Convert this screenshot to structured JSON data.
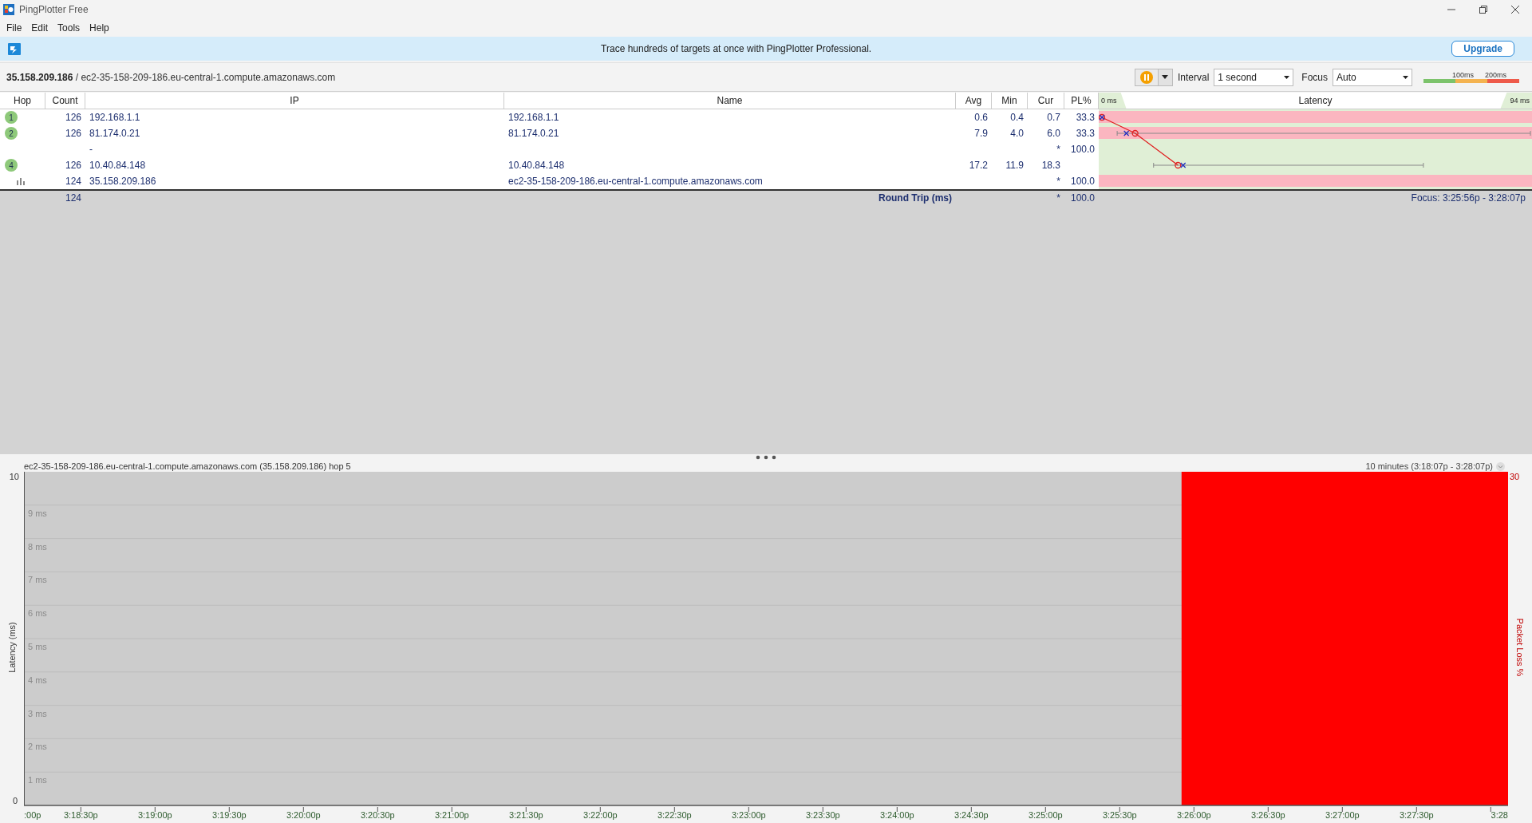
{
  "window": {
    "title": "PingPlotter Free"
  },
  "menu": [
    "File",
    "Edit",
    "Tools",
    "Help"
  ],
  "banner": {
    "message": "Trace hundreds of targets at once with PingPlotter Professional.",
    "button": "Upgrade"
  },
  "target": {
    "address": "**35.158.209.186** / ec2-35-158-209-186.eu-central-1.compute.amazonaws.com"
  },
  "controls": {
    "interval_label": "Interval",
    "interval": "1 second",
    "focus_label": "Focus",
    "focus": "Auto",
    "scale_labels": [
      "100ms",
      "200ms"
    ]
  },
  "table": {
    "columns": [
      "Hop",
      "Count",
      "IP",
      "Name",
      "Avg",
      "Min",
      "Cur",
      "PL%"
    ],
    "latency_header": {
      "min": "0 ms",
      "title": "Latency",
      "max": "94 ms"
    },
    "rows": [
      {
        "kind": "numbered",
        "hop": "1",
        "count": "126",
        "ip": "192.168.1.1",
        "name": "192.168.1.1",
        "avg": "0.6",
        "min": "0.4",
        "cur": "0.7",
        "pl": "33.3",
        "color": "#fbb6c0"
      },
      {
        "kind": "numbered",
        "hop": "2",
        "count": "126",
        "ip": "81.174.0.21",
        "name": "81.174.0.21",
        "avg": "7.9",
        "min": "4.0",
        "cur": "6.0",
        "pl": "33.3",
        "color": "#fbb6c0"
      },
      {
        "kind": "blank",
        "ip": "-",
        "cur": "*",
        "pl": "100.0",
        "color": "#e0efd6"
      },
      {
        "kind": "numbered",
        "hop": "4",
        "count": "126",
        "ip": "10.40.84.148",
        "name": "10.40.84.148",
        "avg": "17.2",
        "min": "11.9",
        "cur": "18.3",
        "color": "#e0efd6"
      },
      {
        "kind": "graphed",
        "count": "124",
        "ip": "35.158.209.186",
        "name": "ec2-35-158-209-186.eu-central-1.compute.amazonaws.com",
        "cur": "*",
        "pl": "100.0",
        "color": "#fbb6c0"
      }
    ],
    "summary": {
      "count": "124",
      "label": "Round Trip (ms)",
      "cur": "*",
      "pl": "100.0",
      "focus": "Focus: 3:25:56p - 3:28:07p"
    }
  },
  "graph": {
    "title": "ec2-35-158-209-186.eu-central-1.compute.amazonaws.com (35.158.209.186) hop 5",
    "range": "10 minutes (3:18:07p - 3:28:07p)",
    "y_axis": {
      "title": "Latency (ms)",
      "max": "10",
      "min": "0",
      "grid_labels": [
        "9 ms",
        "8 ms",
        "7 ms",
        "6 ms",
        "5 ms",
        "4 ms",
        "3 ms",
        "2 ms",
        "1 ms"
      ]
    },
    "loss_axis": {
      "max": "30",
      "label": "Packet Loss %"
    },
    "time_labels": [
      ":00p",
      "3:18:30p",
      "3:19:00p",
      "3:19:30p",
      "3:20:00p",
      "3:20:30p",
      "3:21:00p",
      "3:21:30p",
      "3:22:00p",
      "3:22:30p",
      "3:23:00p",
      "3:23:30p",
      "3:24:00p",
      "3:24:30p",
      "3:25:00p",
      "3:25:30p",
      "3:26:00p",
      "3:26:30p",
      "3:27:00p",
      "3:27:30p",
      "3:28"
    ],
    "loss_band": {
      "level": 0.22
    }
  }
}
